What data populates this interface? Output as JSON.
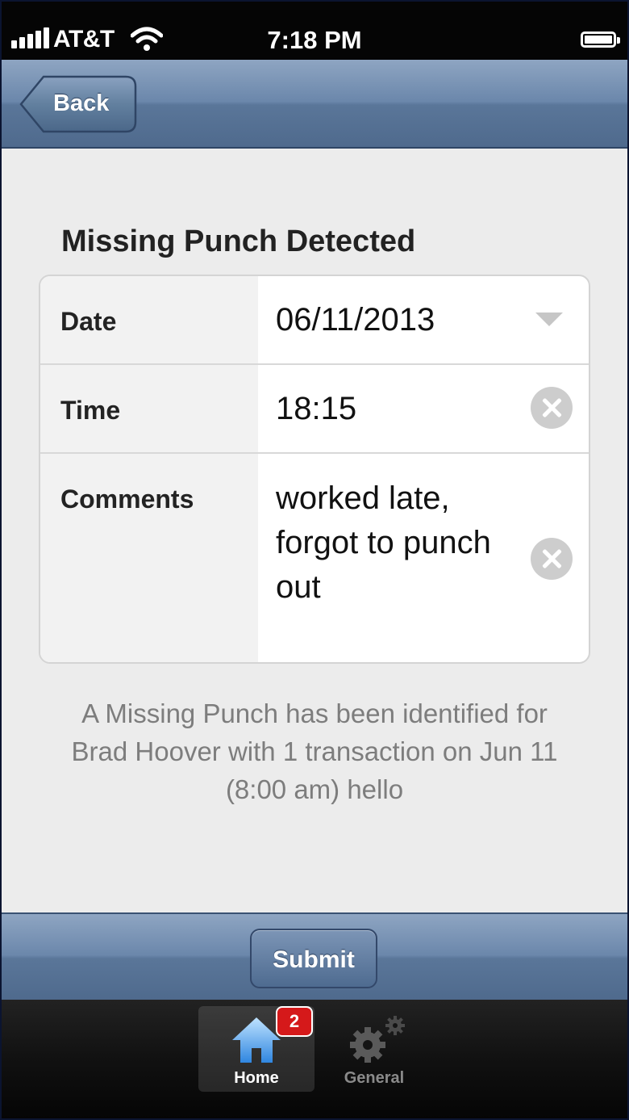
{
  "status_bar": {
    "carrier": "AT&T",
    "time": "7:18 PM"
  },
  "nav": {
    "back_label": "Back"
  },
  "page": {
    "title": "Missing Punch Detected"
  },
  "form": {
    "date_label": "Date",
    "date_value": "06/11/2013",
    "time_label": "Time",
    "time_value": "18:15",
    "comments_label": "Comments",
    "comments_value": "worked late, forgot to punch out"
  },
  "note": "A Missing Punch has been identified for Brad Hoover with 1 transaction on Jun 11 (8:00 am) hello",
  "toolbar": {
    "submit_label": "Submit"
  },
  "tabs": [
    {
      "label": "Home",
      "icon": "home-icon",
      "badge": "2",
      "selected": true
    },
    {
      "label": "General",
      "icon": "gears-icon",
      "selected": false
    }
  ],
  "colors": {
    "bar_blue": "#5a7699",
    "badge_red": "#d5191a"
  }
}
